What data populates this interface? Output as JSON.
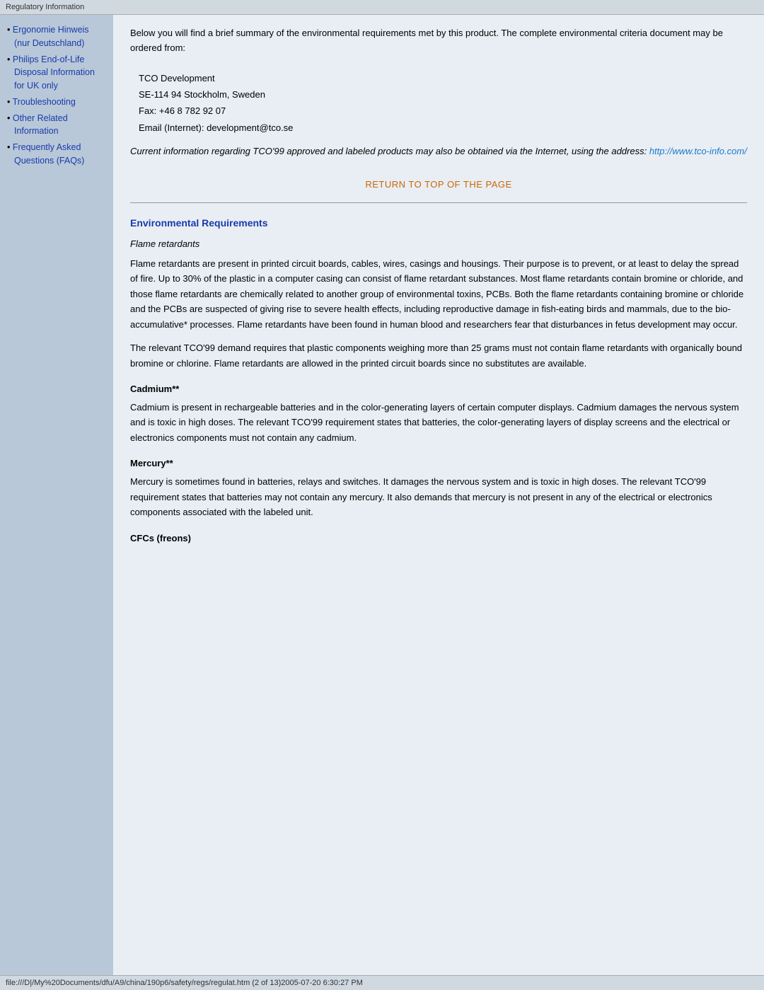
{
  "topBar": {
    "title": "Regulatory Information"
  },
  "sidebar": {
    "items": [
      {
        "label": "Ergonomie Hinweis (nur Deutschland)",
        "href": "#"
      },
      {
        "label": "Philips End-of-Life Disposal Information for UK only",
        "href": "#"
      },
      {
        "label": "Troubleshooting",
        "href": "#"
      },
      {
        "label": "Other Related Information",
        "href": "#"
      },
      {
        "label": "Frequently Asked Questions (FAQs)",
        "href": "#"
      }
    ]
  },
  "content": {
    "intro": "Below you will find a brief summary of the environmental requirements met by this product. The complete environmental criteria document may be ordered from:",
    "address": {
      "line1": "TCO Development",
      "line2": "SE-114 94 Stockholm, Sweden",
      "line3": "Fax: +46 8 782 92 07",
      "line4": "Email (Internet): development@tco.se"
    },
    "italicNote": "Current information regarding TCO'99 approved and labeled products may also be obtained via the Internet, using the address: ",
    "italicLink": "http://www.tco-info.com/",
    "returnLink": "RETURN TO TOP OF THE PAGE",
    "envSection": {
      "title": "Environmental Requirements",
      "flameSubtitle": "Flame retardants",
      "flamePara1": "Flame retardants are present in printed circuit boards, cables, wires, casings and housings. Their purpose is to prevent, or at least to delay the spread of fire. Up to 30% of the plastic in a computer casing can consist of flame retardant substances. Most flame retardants contain bromine or chloride, and those flame retardants are chemically related to another group of environmental toxins, PCBs. Both the flame retardants containing bromine or chloride and the PCBs are suspected of giving rise to severe health effects, including reproductive damage in fish-eating birds and mammals, due to the bio-accumulative* processes. Flame retardants have been found in human blood and researchers fear that disturbances in fetus development may occur.",
      "flamePara2": "The relevant TCO'99 demand requires that plastic components weighing more than 25 grams must not contain flame retardants with organically bound bromine or chlorine. Flame retardants are allowed in the printed circuit boards since no substitutes are available.",
      "cadmiumTitle": "Cadmium**",
      "cadmiumPara": "Cadmium is present in rechargeable batteries and in the color-generating layers of certain computer displays. Cadmium damages the nervous system and is toxic in high doses. The relevant TCO'99 requirement states that batteries, the color-generating layers of display screens and the electrical or electronics components must not contain any cadmium.",
      "mercuryTitle": "Mercury**",
      "mercuryPara": "Mercury is sometimes found in batteries, relays and switches. It damages the nervous system and is toxic in high doses. The relevant TCO'99 requirement states that batteries may not contain any mercury. It also demands that mercury is not present in any of the electrical or electronics components associated with the labeled unit.",
      "cfcTitle": "CFCs (freons)"
    }
  },
  "bottomBar": {
    "text": "file:///D|/My%20Documents/dfu/A9/china/190p6/safety/regs/regulat.htm (2 of 13)2005-07-20 6:30:27 PM"
  }
}
